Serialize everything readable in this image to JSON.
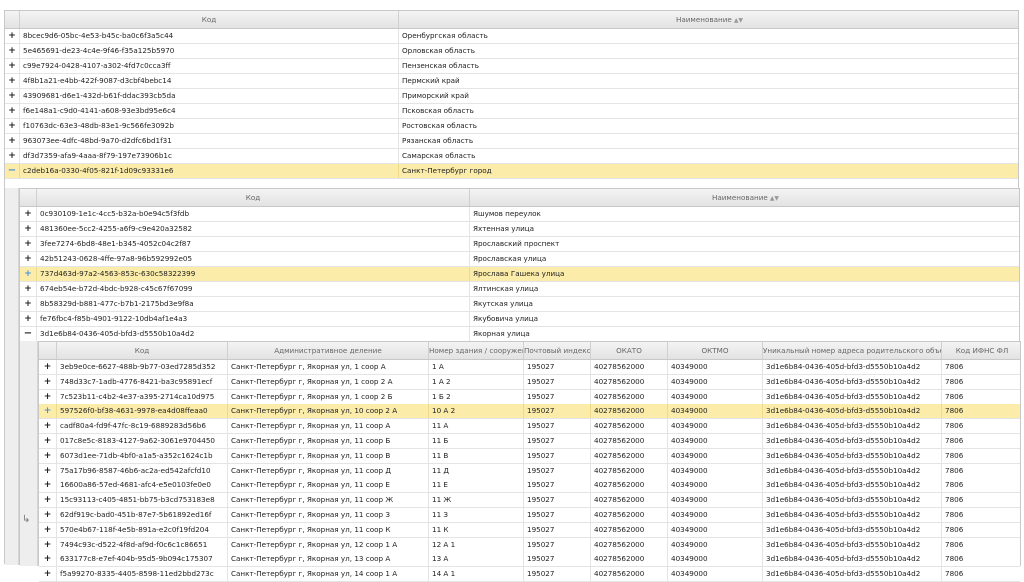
{
  "level1": {
    "columns": {
      "code": "Код",
      "name": "Наименование"
    },
    "rows": [
      {
        "code": "8bcec9d6-05bc-4e53-b45c-ba0c6f3a5c44",
        "name": "Оренбургская область",
        "expander": "+"
      },
      {
        "code": "5e465691-de23-4c4e-9f46-f35a125b5970",
        "name": "Орловская область",
        "expander": "+"
      },
      {
        "code": "c99e7924-0428-4107-a302-4fd7c0cca3ff",
        "name": "Пензенская область",
        "expander": "+"
      },
      {
        "code": "4f8b1a21-e4bb-422f-9087-d3cbf4bebc14",
        "name": "Пермский край",
        "expander": "+"
      },
      {
        "code": "43909681-d6e1-432d-b61f-ddac393cb5da",
        "name": "Приморский край",
        "expander": "+"
      },
      {
        "code": "f6e148a1-c9d0-4141-a608-93e3bd95e6c4",
        "name": "Псковская область",
        "expander": "+"
      },
      {
        "code": "f10763dc-63e3-48db-83e1-9c566fe3092b",
        "name": "Ростовская область",
        "expander": "+"
      },
      {
        "code": "963073ee-4dfc-48bd-9a70-d2dfc6bd1f31",
        "name": "Рязанская область",
        "expander": "+"
      },
      {
        "code": "df3d7359-afa9-4aaa-8f79-197e73906b1c",
        "name": "Самарская область",
        "expander": "+"
      },
      {
        "code": "c2deb16a-0330-4f05-821f-1d09c93331e6",
        "name": "Санкт-Петербург город",
        "expander": "−"
      }
    ]
  },
  "level2": {
    "columns": {
      "code": "Код",
      "name": "Наименование"
    },
    "rows": [
      {
        "code": "0c930109-1e1c-4cc5-b32a-b0e94c5f3fdb",
        "name": "Яшумов переулок",
        "expander": "+"
      },
      {
        "code": "481360ee-5cc2-4255-a6f9-c9e420a32582",
        "name": "Яхтенная улица",
        "expander": "+"
      },
      {
        "code": "3fee7274-6bd8-48e1-b345-4052c04c2f87",
        "name": "Ярославский проспект",
        "expander": "+"
      },
      {
        "code": "42b51243-0628-4ffe-97a8-96b592992e05",
        "name": "Ярославская улица",
        "expander": "+"
      },
      {
        "code": "737d463d-97a2-4563-853c-630c58322399",
        "name": "Ярослава Гашека улица",
        "expander": "+"
      },
      {
        "code": "674eb54e-b72d-4bdc-b928-c45c67f67099",
        "name": "Ялтинская улица",
        "expander": "+"
      },
      {
        "code": "8b58329d-b881-477c-b7b1-2175bd3e9f8a",
        "name": "Якутская улица",
        "expander": "+"
      },
      {
        "code": "fe76fbc4-f85b-4901-9122-10db4af1e4a3",
        "name": "Якубовича улица",
        "expander": "+"
      },
      {
        "code": "3d1e6b84-0436-405d-bfd3-d5550b10a4d2",
        "name": "Якорная улица",
        "expander": "−"
      }
    ]
  },
  "level3": {
    "columns": {
      "code": "Код",
      "admin": "Административное деление",
      "building": "Номер здания / сооружения",
      "postal": "Почтовый индекс",
      "okato": "ОКАТО",
      "oktmo": "ОКТМО",
      "parent": "Уникальный номер адреса родительского объекта",
      "ifns": "Код ИФНС ФЛ"
    },
    "rows": [
      {
        "code": "3eb9e0ce-6627-488b-9b77-03ed7285d352",
        "admin": "Санкт-Петербург г, Якорная ул, 1 соор А",
        "building": "1 А",
        "postal": "195027",
        "okato": "40278562000",
        "oktmo": "40349000",
        "parent": "3d1e6b84-0436-405d-bfd3-d5550b10a4d2",
        "ifns": "7806"
      },
      {
        "code": "748d33c7-1adb-4776-8421-ba3c95891ecf",
        "admin": "Санкт-Петербург г, Якорная ул, 1 соор 2 А",
        "building": "1 А 2",
        "postal": "195027",
        "okato": "40278562000",
        "oktmo": "40349000",
        "parent": "3d1e6b84-0436-405d-bfd3-d5550b10a4d2",
        "ifns": "7806"
      },
      {
        "code": "7c523b11-c4b2-4e37-a395-2714ca10d975",
        "admin": "Санкт-Петербург г, Якорная ул, 1 соор 2 Б",
        "building": "1 Б 2",
        "postal": "195027",
        "okato": "40278562000",
        "oktmo": "40349000",
        "parent": "3d1e6b84-0436-405d-bfd3-d5550b10a4d2",
        "ifns": "7806"
      },
      {
        "code": "597526f0-bf38-4631-9978-ea4d08ffeaa0",
        "admin": "Санкт-Петербург г, Якорная ул, 10 соор 2 А",
        "building": "10 А 2",
        "postal": "195027",
        "okato": "40278562000",
        "oktmo": "40349000",
        "parent": "3d1e6b84-0436-405d-bfd3-d5550b10a4d2",
        "ifns": "7806"
      },
      {
        "code": "cadf80a4-fd9f-47fc-8c19-6889283d56b6",
        "admin": "Санкт-Петербург г, Якорная ул, 11 соор А",
        "building": "11 А",
        "postal": "195027",
        "okato": "40278562000",
        "oktmo": "40349000",
        "parent": "3d1e6b84-0436-405d-bfd3-d5550b10a4d2",
        "ifns": "7806"
      },
      {
        "code": "017c8e5c-8183-4127-9a62-3061e9704450",
        "admin": "Санкт-Петербург г, Якорная ул, 11 соор Б",
        "building": "11 Б",
        "postal": "195027",
        "okato": "40278562000",
        "oktmo": "40349000",
        "parent": "3d1e6b84-0436-405d-bfd3-d5550b10a4d2",
        "ifns": "7806"
      },
      {
        "code": "6073d1ee-71db-4bf0-a1a5-a352c1624c1b",
        "admin": "Санкт-Петербург г, Якорная ул, 11 соор В",
        "building": "11 В",
        "postal": "195027",
        "okato": "40278562000",
        "oktmo": "40349000",
        "parent": "3d1e6b84-0436-405d-bfd3-d5550b10a4d2",
        "ifns": "7806"
      },
      {
        "code": "75a17b96-8587-46b6-ac2a-ed542afcfd10",
        "admin": "Санкт-Петербург г, Якорная ул, 11 соор Д",
        "building": "11 Д",
        "postal": "195027",
        "okato": "40278562000",
        "oktmo": "40349000",
        "parent": "3d1e6b84-0436-405d-bfd3-d5550b10a4d2",
        "ifns": "7806"
      },
      {
        "code": "16600a86-57ed-4681-afc4-e5e0103fe0e0",
        "admin": "Санкт-Петербург г, Якорная ул, 11 соор Е",
        "building": "11 Е",
        "postal": "195027",
        "okato": "40278562000",
        "oktmo": "40349000",
        "parent": "3d1e6b84-0436-405d-bfd3-d5550b10a4d2",
        "ifns": "7806"
      },
      {
        "code": "15c93113-c405-4851-bb75-b3cd753183e8",
        "admin": "Санкт-Петербург г, Якорная ул, 11 соор Ж",
        "building": "11 Ж",
        "postal": "195027",
        "okato": "40278562000",
        "oktmo": "40349000",
        "parent": "3d1e6b84-0436-405d-bfd3-d5550b10a4d2",
        "ifns": "7806"
      },
      {
        "code": "62df919c-bad0-451b-87e7-5b61892ed16f",
        "admin": "Санкт-Петербург г, Якорная ул, 11 соор З",
        "building": "11 З",
        "postal": "195027",
        "okato": "40278562000",
        "oktmo": "40349000",
        "parent": "3d1e6b84-0436-405d-bfd3-d5550b10a4d2",
        "ifns": "7806"
      },
      {
        "code": "570e4b67-118f-4e5b-891a-e2c0f19fd204",
        "admin": "Санкт-Петербург г, Якорная ул, 11 соор К",
        "building": "11 К",
        "postal": "195027",
        "okato": "40278562000",
        "oktmo": "40349000",
        "parent": "3d1e6b84-0436-405d-bfd3-d5550b10a4d2",
        "ifns": "7806"
      },
      {
        "code": "7494c93c-d522-4f8d-af9d-f0c6c1c86651",
        "admin": "Санкт-Петербург г, Якорная ул, 12 соор 1 А",
        "building": "12 А 1",
        "postal": "195027",
        "okato": "40278562000",
        "oktmo": "40349000",
        "parent": "3d1e6b84-0436-405d-bfd3-d5550b10a4d2",
        "ifns": "7806"
      },
      {
        "code": "633177c8-e7ef-404b-95d5-9b094c175307",
        "admin": "Санкт-Петербург г, Якорная ул, 13 соор А",
        "building": "13 А",
        "postal": "195027",
        "okato": "40278562000",
        "oktmo": "40349000",
        "parent": "3d1e6b84-0436-405d-bfd3-d5550b10a4d2",
        "ifns": "7806"
      },
      {
        "code": "f5a99270-8335-4405-8598-11ed2bbd273c",
        "admin": "Санкт-Петербург г, Якорная ул, 14 соор 1 А",
        "building": "14 А 1",
        "postal": "195027",
        "okato": "40278562000",
        "oktmo": "40349000",
        "parent": "3d1e6b84-0436-405d-bfd3-d5550b10a4d2",
        "ifns": "7806"
      }
    ]
  },
  "selection": {
    "level1_row": 9,
    "level2_row": 4,
    "level3_row": 3
  },
  "icons": {
    "expand": "plus-icon",
    "collapse": "minus-icon",
    "sort": "sort-icon",
    "subgrid": "subgrid-arrow-icon"
  },
  "colors": {
    "selected_row": "#fbeca9",
    "header_bg": "#e9e9e9",
    "border": "#c8c8c8",
    "selected_expander": "#4a90d9"
  }
}
